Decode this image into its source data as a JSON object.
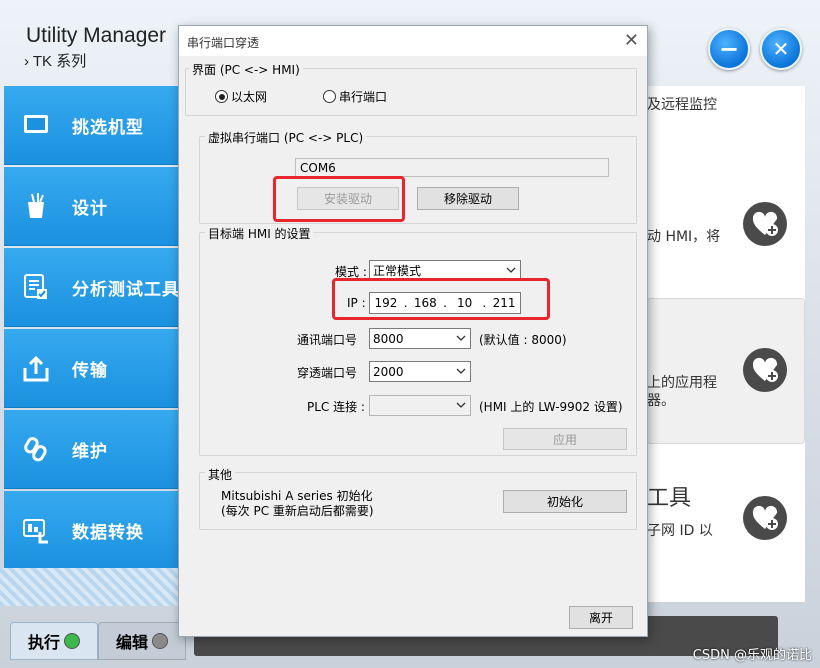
{
  "app": {
    "title": "Utility Manager",
    "subtitle": "› TK 系列",
    "minimize_symbol": "−",
    "close_symbol": "✕",
    "accent": "#1e95e2",
    "sidebar": {
      "items": [
        {
          "label": "挑选机型",
          "icon": "monitor-icon"
        },
        {
          "label": "设计",
          "icon": "pencil-cup-icon"
        },
        {
          "label": "分析测试工具",
          "icon": "checklist-icon"
        },
        {
          "label": "传输",
          "icon": "upload-icon"
        },
        {
          "label": "维护",
          "icon": "link-icon"
        },
        {
          "label": "数据转换",
          "icon": "data-convert-icon"
        }
      ]
    },
    "bottom_tabs": {
      "run": "执行",
      "edit": "编辑"
    },
    "right_panel": {
      "text1": "及远程监控",
      "text2": "动 HMI，将",
      "text3a": "上的应用程",
      "text3b": "器。",
      "text4a": "工具",
      "text4b": "子网 ID 以"
    },
    "watermark": "CSDN @乐观的诺比"
  },
  "dialog": {
    "title": "串行端口穿透",
    "close_symbol": "✕",
    "interface_group": {
      "legend": "界面 (PC <-> HMI)",
      "options": [
        "以太网",
        "串行端口"
      ],
      "selected": "以太网"
    },
    "virtual_port_group": {
      "legend": "虚拟串行端口 (PC <-> PLC)",
      "port_value": "COM6",
      "install_button": "安装驱动",
      "remove_button": "移除驱动"
    },
    "hmi_settings_group": {
      "legend": "目标端 HMI 的设置",
      "mode_label": "模式 :",
      "mode_value": "正常模式",
      "ip_label": "IP :",
      "ip": [
        "192",
        "168",
        "10",
        "211"
      ],
      "comm_port_label": "通讯端口号",
      "comm_port_value": "8000",
      "comm_port_default": "(默认值 : 8000)",
      "pass_port_label": "穿透端口号",
      "pass_port_value": "2000",
      "plc_label": "PLC 连接 :",
      "plc_value": "",
      "plc_note": "(HMI 上的 LW-9902 设置)",
      "apply_button": "应用"
    },
    "other_group": {
      "legend": "其他",
      "line1": "Mitsubishi A series 初始化",
      "line2": "(每次 PC 重新启动后都需要)",
      "init_button": "初始化"
    },
    "leave_button": "离开"
  }
}
